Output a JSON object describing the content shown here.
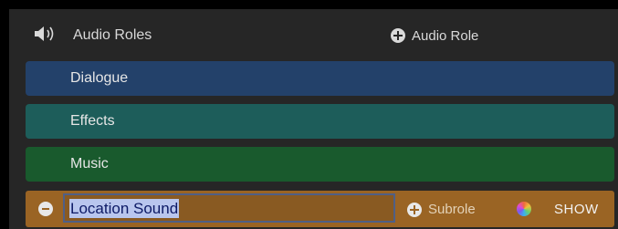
{
  "header": {
    "title": "Audio Roles",
    "add_role_label": "Audio Role",
    "speaker_icon": "speaker-icon",
    "add_icon": "plus-circle-icon"
  },
  "roles": [
    {
      "label": "Dialogue",
      "color": "#23416a"
    },
    {
      "label": "Effects",
      "color": "#1d5d5a"
    },
    {
      "label": "Music",
      "color": "#195a2d"
    }
  ],
  "editing_role": {
    "name_value": "Location Sound",
    "color": "#9a6424",
    "remove_icon": "minus-circle-icon",
    "subrole_label": "Subrole",
    "color_picker_icon": "color-wheel-icon",
    "show_label": "SHOW"
  }
}
